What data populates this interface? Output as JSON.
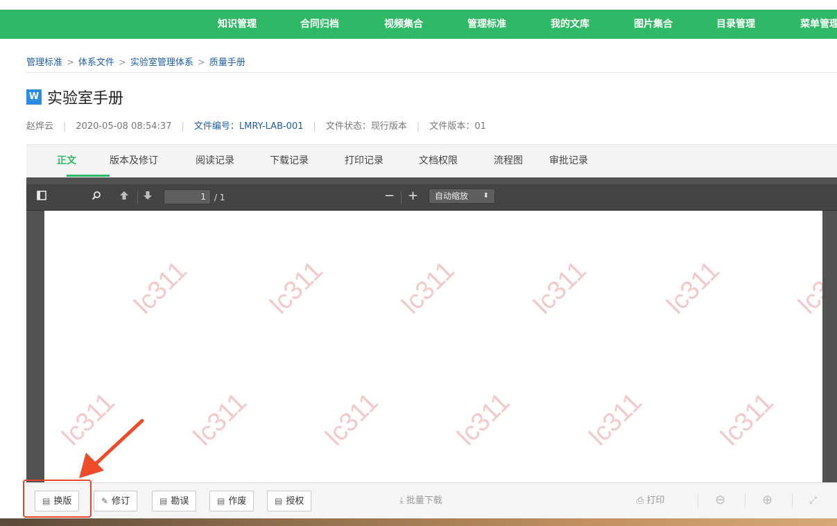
{
  "nav": {
    "items": [
      "知识管理",
      "合同归档",
      "视频集合",
      "管理标准",
      "我的文库",
      "图片集合",
      "目录管理",
      "菜单管理"
    ]
  },
  "breadcrumb": [
    "管理标准",
    "体系文件",
    "实验室管理体系",
    "质量手册"
  ],
  "doc": {
    "type_badge": "W",
    "title": "实验室手册",
    "author": "赵烨云",
    "datetime": "2020-05-08 08:54:37",
    "code_label": "文件编号：",
    "code": "LMRY-LAB-001",
    "status_label": "文件状态：",
    "status": "现行版本",
    "version_label": "文件版本：",
    "version": "01"
  },
  "tabs": [
    "正文",
    "版本及修订",
    "阅读记录",
    "下载记录",
    "打印记录",
    "文档权限",
    "流程图",
    "审批记录"
  ],
  "viewer": {
    "page_current": "1",
    "page_total": "/ 1",
    "zoom": "自动缩放",
    "watermark": "lc311"
  },
  "actions": {
    "replace": "换版",
    "revise": "修订",
    "erratum": "勘误",
    "void": "作废",
    "authorize": "授权",
    "batch_download": "批量下载",
    "print": "打印"
  },
  "colors": {
    "nav_green": "#2fb865",
    "link_blue": "#1f5fa6",
    "highlight_red": "#e8462c"
  }
}
